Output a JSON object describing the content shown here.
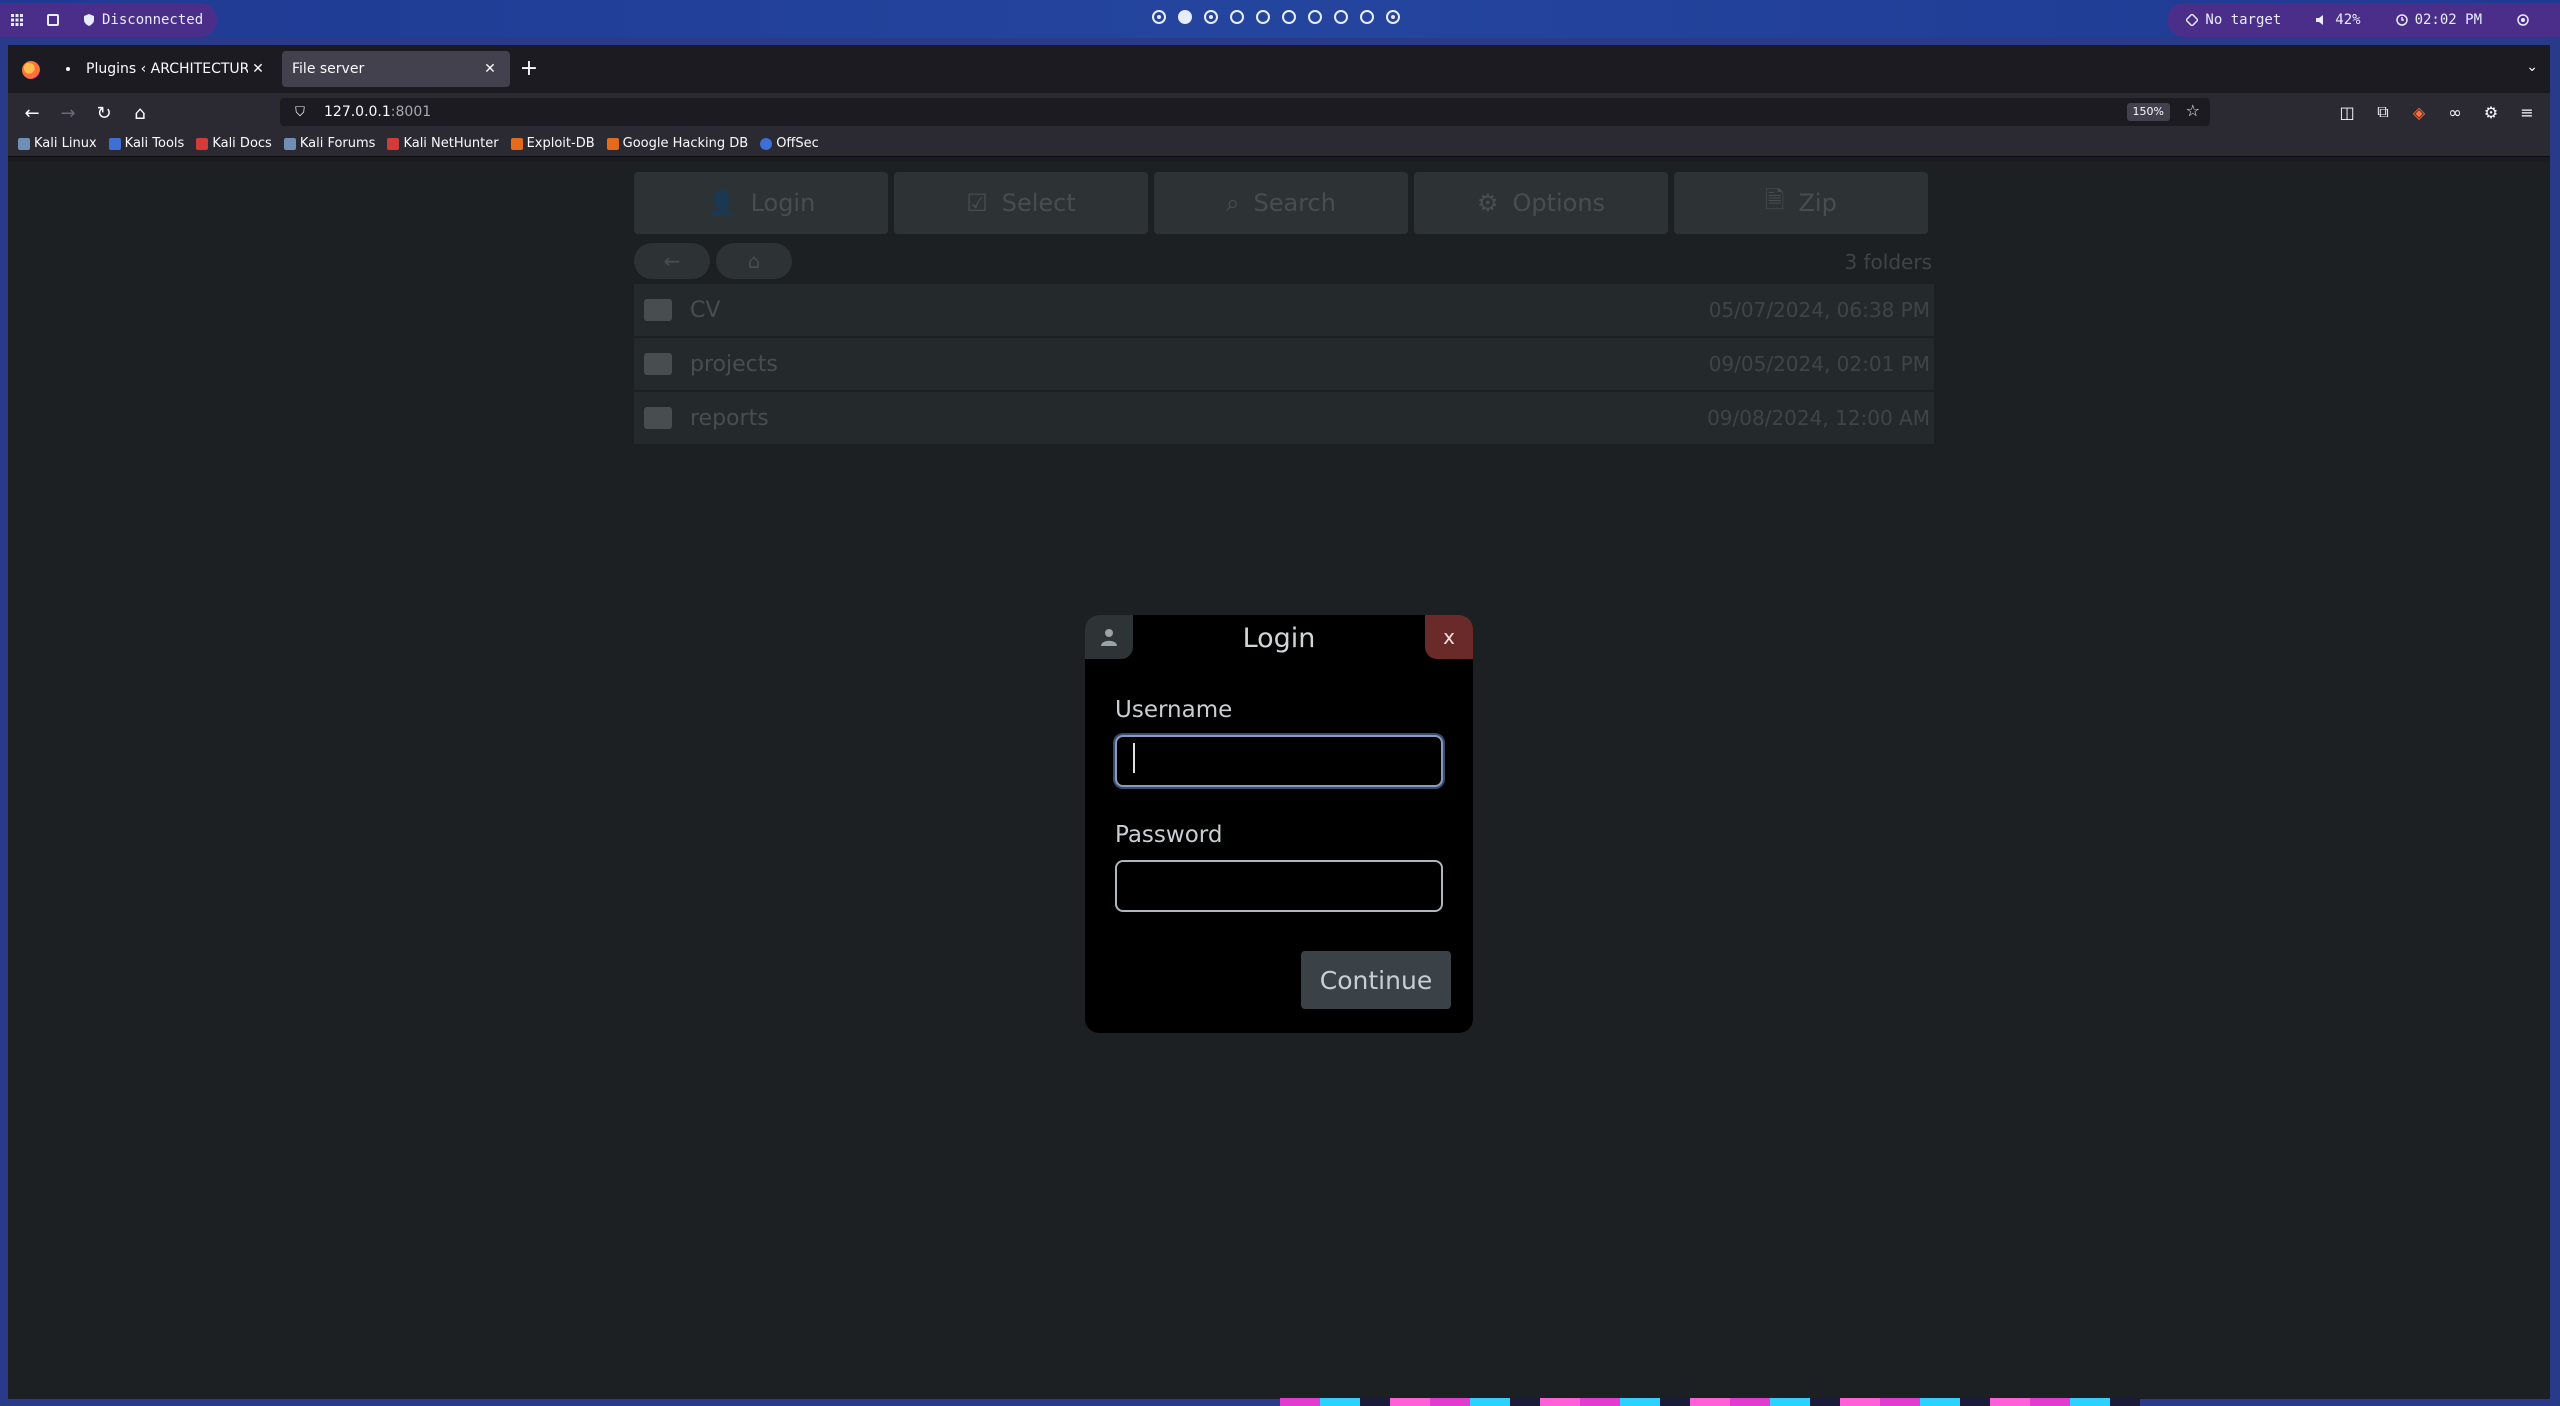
{
  "sysbar": {
    "connection_status": "Disconnected",
    "target": "No target",
    "volume": "42%",
    "time": "02:02 PM",
    "workspaces": [
      "dot",
      "filled",
      "dot",
      "empty",
      "empty",
      "empty",
      "empty",
      "empty",
      "empty",
      "dot"
    ]
  },
  "browser": {
    "tabs": [
      {
        "title": "Plugins ‹ ARCHITECTURE, …",
        "active": false
      },
      {
        "title": "File server",
        "active": true
      }
    ],
    "url_host": "127.0.0.1",
    "url_port": ":8001",
    "zoom": "150%",
    "bookmarks": [
      {
        "label": "Kali Linux",
        "icon": "kali-dragon-icon",
        "color": "#6f8fb6"
      },
      {
        "label": "Kali Tools",
        "icon": "kali-tools-icon",
        "color": "#3d6fd6"
      },
      {
        "label": "Kali Docs",
        "icon": "kali-docs-icon",
        "color": "#d43a3a"
      },
      {
        "label": "Kali Forums",
        "icon": "kali-forums-icon",
        "color": "#6f8fb6"
      },
      {
        "label": "Kali NetHunter",
        "icon": "nethunter-icon",
        "color": "#d43a3a"
      },
      {
        "label": "Exploit-DB",
        "icon": "exploit-db-icon",
        "color": "#e36a1b"
      },
      {
        "label": "Google Hacking DB",
        "icon": "ghdb-icon",
        "color": "#e36a1b"
      },
      {
        "label": "OffSec",
        "icon": "offsec-icon",
        "color": "#3d6fd6"
      }
    ]
  },
  "fileserver": {
    "toolbar": [
      {
        "label": "Login",
        "icon": "user-icon"
      },
      {
        "label": "Select",
        "icon": "checkbox-icon"
      },
      {
        "label": "Search",
        "icon": "search-icon"
      },
      {
        "label": "Options",
        "icon": "gear-icon"
      },
      {
        "label": "Zip",
        "icon": "zip-icon"
      }
    ],
    "folder_count": "3 folders",
    "folders": [
      {
        "name": "CV",
        "date": "05/07/2024, 06:38 PM"
      },
      {
        "name": "projects",
        "date": "09/05/2024, 02:01 PM"
      },
      {
        "name": "reports",
        "date": "09/08/2024, 12:00 AM"
      }
    ]
  },
  "login": {
    "title": "Login",
    "close_label": "x",
    "username_label": "Username",
    "username_value": "",
    "password_label": "Password",
    "password_value": "",
    "continue_label": "Continue"
  }
}
